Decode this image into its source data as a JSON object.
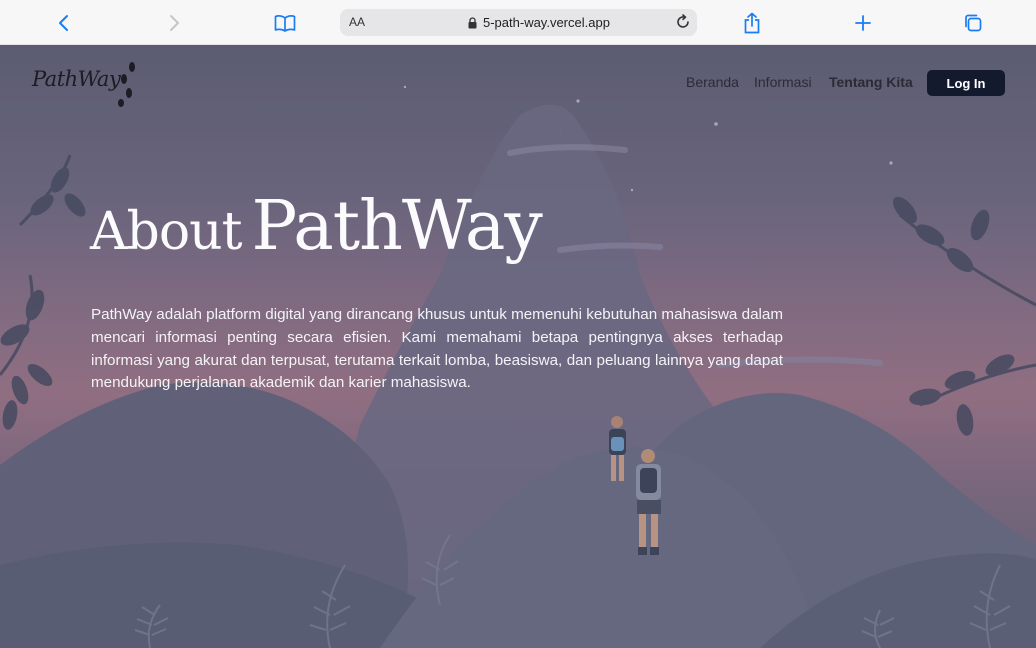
{
  "browser": {
    "address_small_text": "AA",
    "url": "5-path-way.vercel.app"
  },
  "site": {
    "logo_text": "PathWay",
    "nav": {
      "beranda": "Beranda",
      "informasi": "Informasi",
      "tentang": "Tentang Kita"
    },
    "login_label": "Log In"
  },
  "hero": {
    "title_part1": "About",
    "title_part2": "PathWay",
    "description": "PathWay adalah platform digital yang dirancang khusus untuk memenuhi kebutuhan mahasiswa dalam mencari informasi penting secara efisien. Kami memahami betapa pentingnya akses terhadap informasi yang akurat dan terpusat, terutama terkait lomba, beasiswa, dan peluang lainnya yang dapat mendukung perjalanan akademik dan karier mahasiswa."
  },
  "colors": {
    "accent": "#1a7cf5",
    "login_bg": "#141a2e"
  },
  "icons": [
    "back-icon",
    "forward-icon",
    "bookmarks-icon",
    "lock-icon",
    "reload-icon",
    "share-icon",
    "new-tab-icon",
    "tabs-icon"
  ]
}
